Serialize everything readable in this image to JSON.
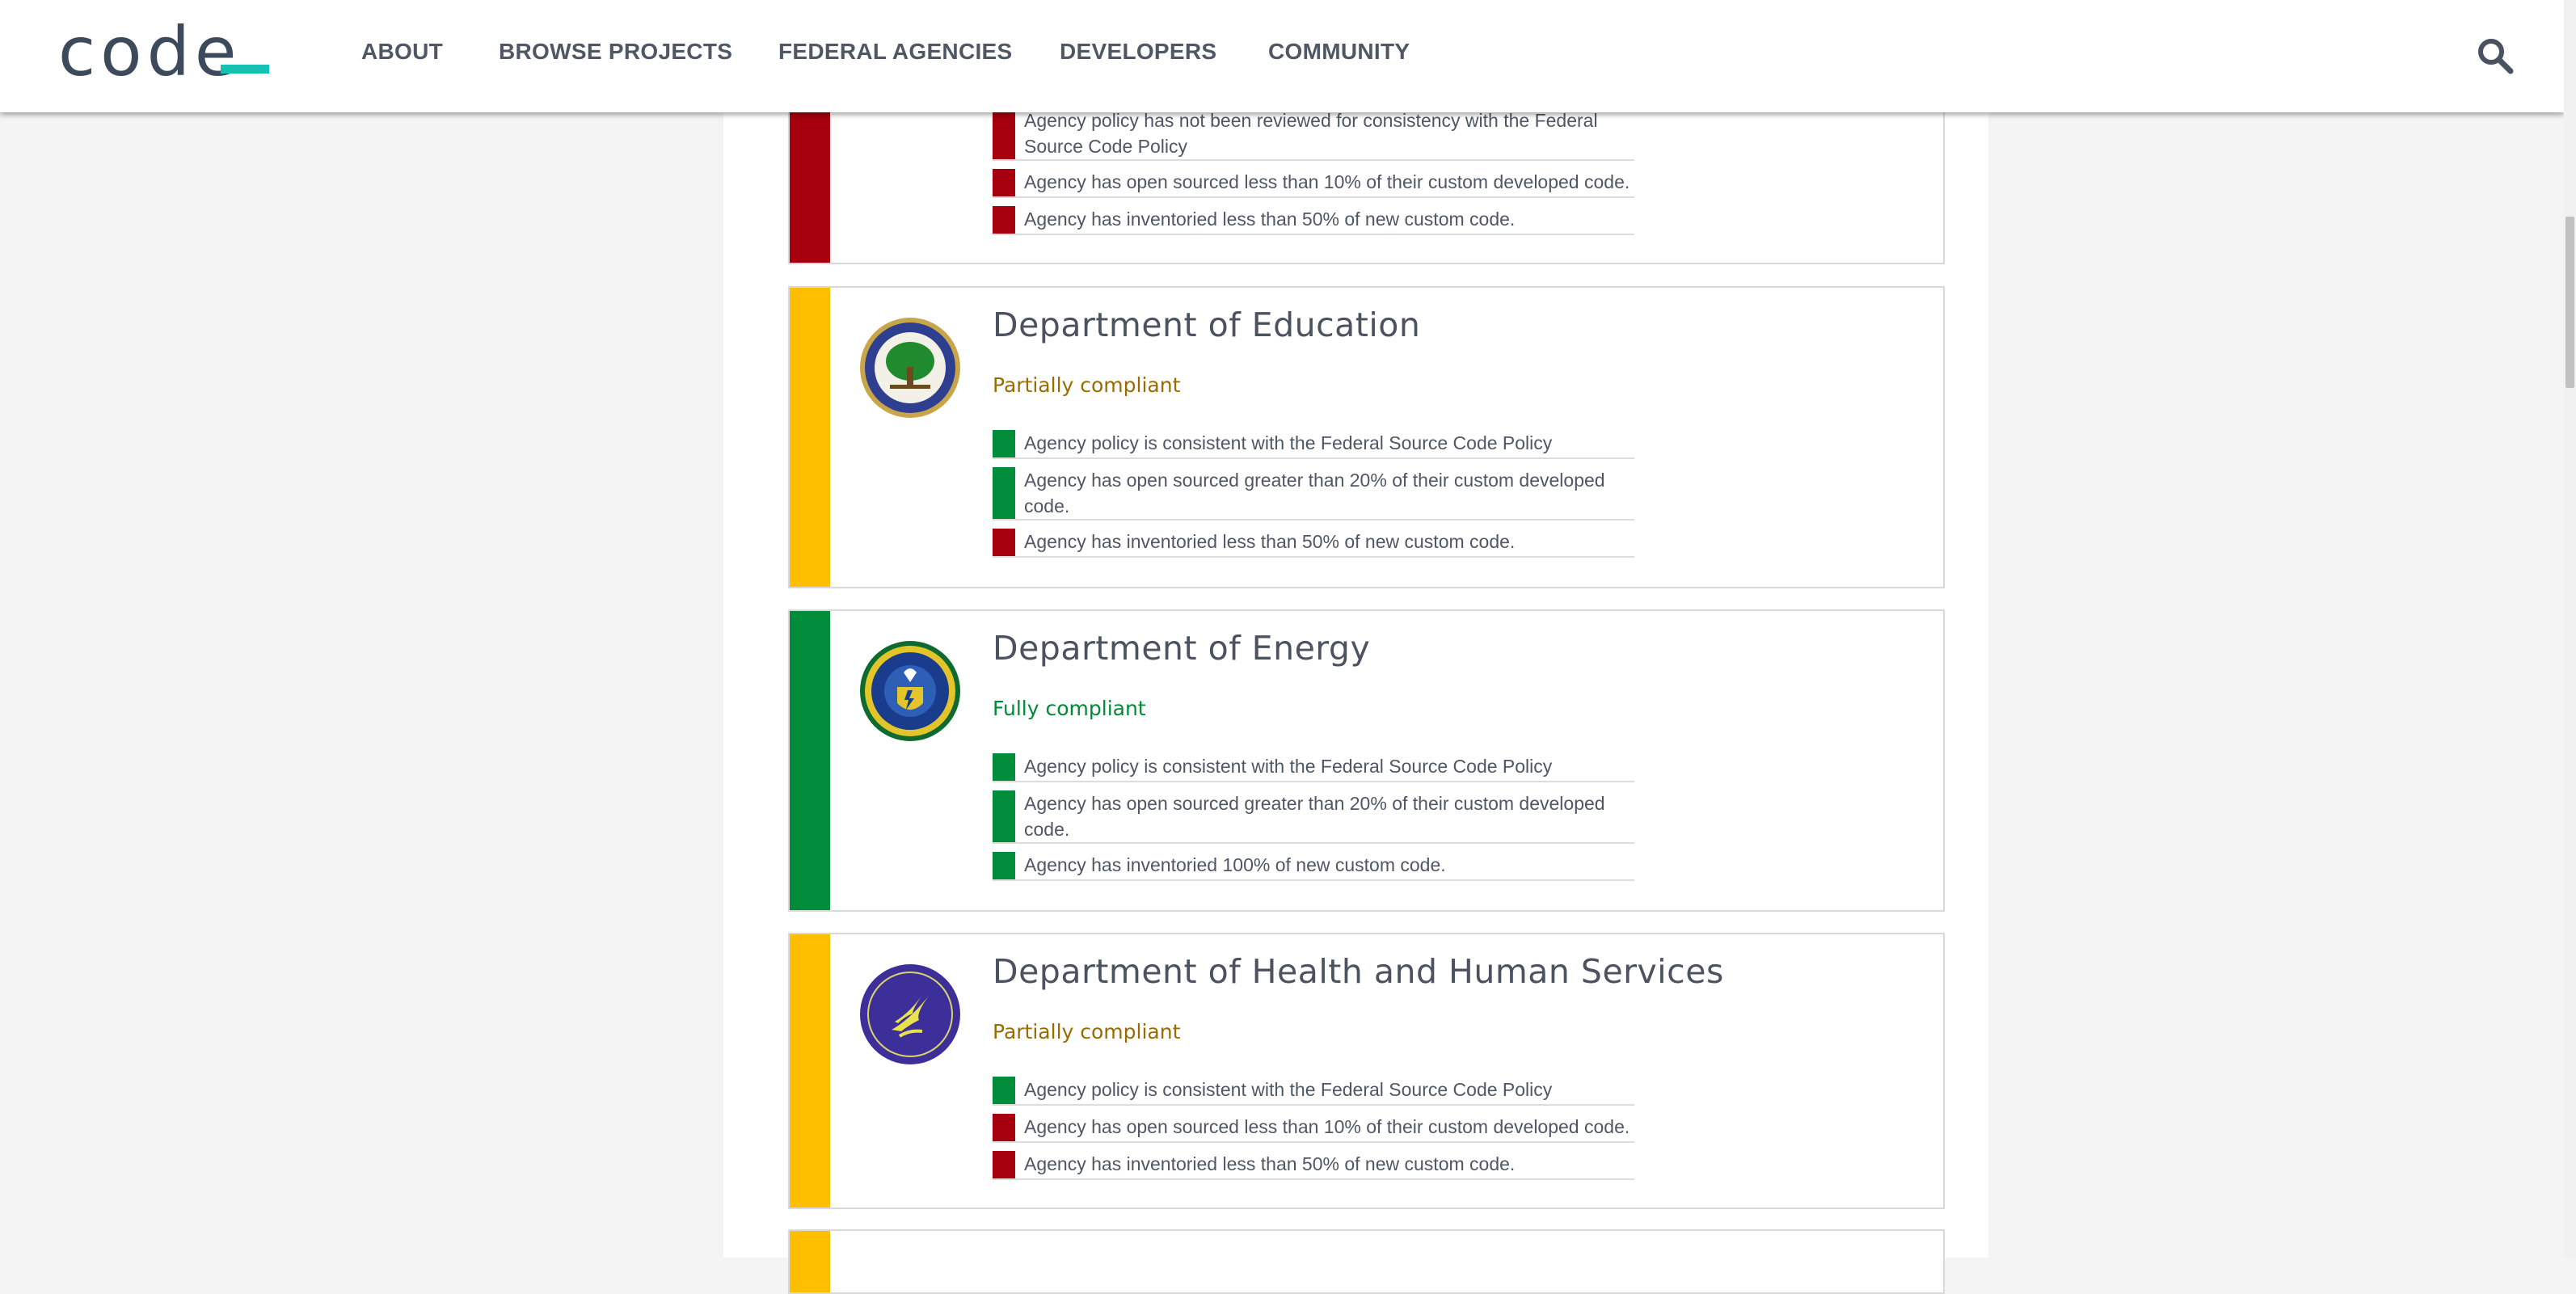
{
  "header": {
    "logo_text": "code",
    "nav": [
      "ABOUT",
      "BROWSE PROJECTS",
      "FEDERAL AGENCIES",
      "DEVELOPERS",
      "COMMUNITY"
    ],
    "search_icon": "search-icon"
  },
  "colors": {
    "compliant_green": "#008c3a",
    "partial_yellow": "#ffbe00",
    "noncompliant_red": "#a6000f",
    "brand_teal": "#16c1b4"
  },
  "cards": [
    {
      "name": "",
      "status": "",
      "criteria": [
        {
          "status": "red",
          "text": "Agency policy has not been reviewed for consistency with the Federal Source Code Policy"
        },
        {
          "status": "red",
          "text": "Agency has open sourced less than 10% of their custom developed code."
        },
        {
          "status": "red",
          "text": "Agency has inventoried less than 50% of new custom code."
        }
      ]
    },
    {
      "name": "Department of Education",
      "status": "Partially compliant",
      "seal_text": "DEPARTMENT OF EDUCATION",
      "criteria": [
        {
          "status": "green",
          "text": "Agency policy is consistent with the Federal Source Code Policy"
        },
        {
          "status": "green",
          "text": "Agency has open sourced greater than 20% of their custom developed code."
        },
        {
          "status": "red",
          "text": "Agency has inventoried less than 50% of new custom code."
        }
      ]
    },
    {
      "name": "Department of Energy",
      "status": "Fully compliant",
      "seal_text": "DEPARTMENT OF ENERGY",
      "criteria": [
        {
          "status": "green",
          "text": "Agency policy is consistent with the Federal Source Code Policy"
        },
        {
          "status": "green",
          "text": "Agency has open sourced greater than 20% of their custom developed code."
        },
        {
          "status": "green",
          "text": "Agency has inventoried 100% of new custom code."
        }
      ]
    },
    {
      "name": "Department of Health and Human Services",
      "status": "Partially compliant",
      "seal_text": "DEPARTMENT OF HEALTH & HUMAN SERVICES USA",
      "criteria": [
        {
          "status": "green",
          "text": "Agency policy is consistent with the Federal Source Code Policy"
        },
        {
          "status": "red",
          "text": "Agency has open sourced less than 10% of their custom developed code."
        },
        {
          "status": "red",
          "text": "Agency has inventoried less than 50% of new custom code."
        }
      ]
    }
  ]
}
